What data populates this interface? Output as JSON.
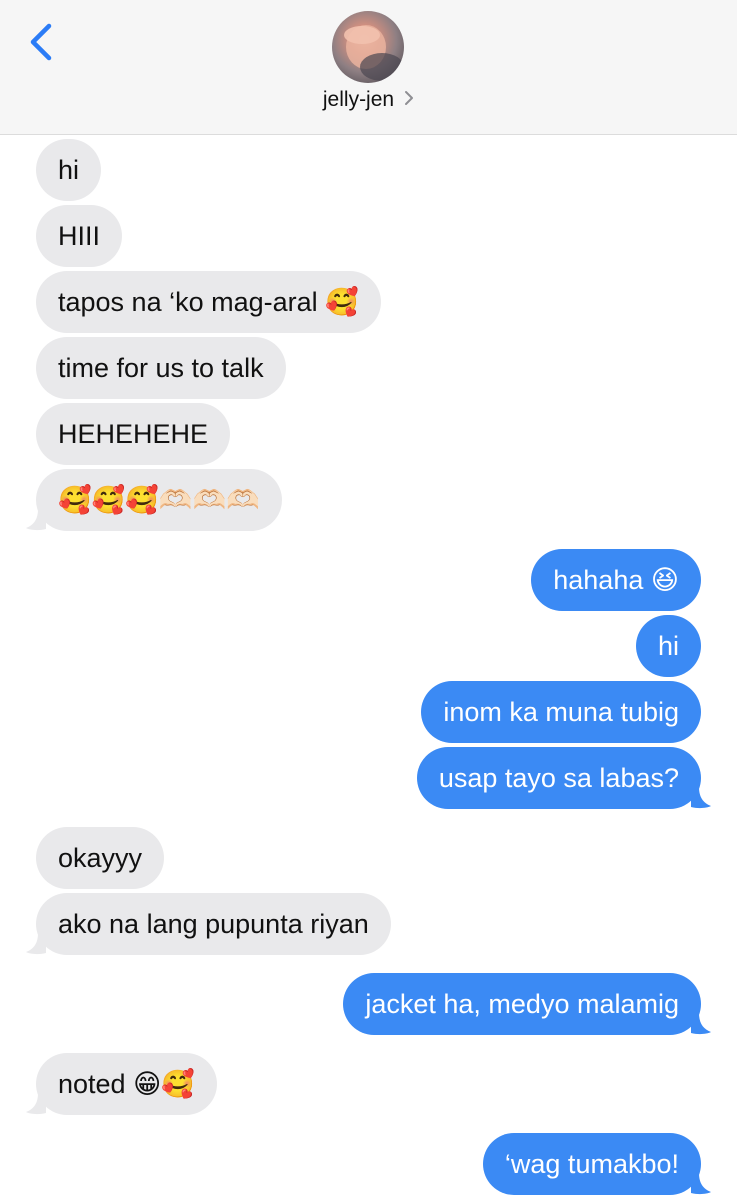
{
  "header": {
    "contact_name": "jelly-jen",
    "back_icon": "chevron-left-icon",
    "details_icon": "chevron-right-icon",
    "accent_color": "#2b7cf6"
  },
  "messages": [
    {
      "direction": "incoming",
      "text": "hi"
    },
    {
      "direction": "incoming",
      "text": "HIII"
    },
    {
      "direction": "incoming",
      "text": "tapos na ‘ko mag-aral 🥰"
    },
    {
      "direction": "incoming",
      "text": "time for us to talk"
    },
    {
      "direction": "incoming",
      "text": "HEHEHEHE"
    },
    {
      "direction": "incoming",
      "text": "🥰🥰🥰🫶🏻🫶🏻🫶🏻"
    },
    {
      "direction": "outgoing",
      "text": "hahaha 😆"
    },
    {
      "direction": "outgoing",
      "text": "hi"
    },
    {
      "direction": "outgoing",
      "text": "inom ka muna tubig"
    },
    {
      "direction": "outgoing",
      "text": "usap tayo sa labas?"
    },
    {
      "direction": "incoming",
      "text": "okayyy"
    },
    {
      "direction": "incoming",
      "text": "ako na lang pupunta riyan"
    },
    {
      "direction": "outgoing",
      "text": "jacket ha, medyo malamig"
    },
    {
      "direction": "incoming",
      "text": "noted 😁🥰"
    },
    {
      "direction": "outgoing",
      "text": "‘wag tumakbo!"
    }
  ],
  "colors": {
    "incoming_bubble": "#e9e9eb",
    "outgoing_bubble": "#3b8af4",
    "header_bg": "#f6f6f6"
  }
}
